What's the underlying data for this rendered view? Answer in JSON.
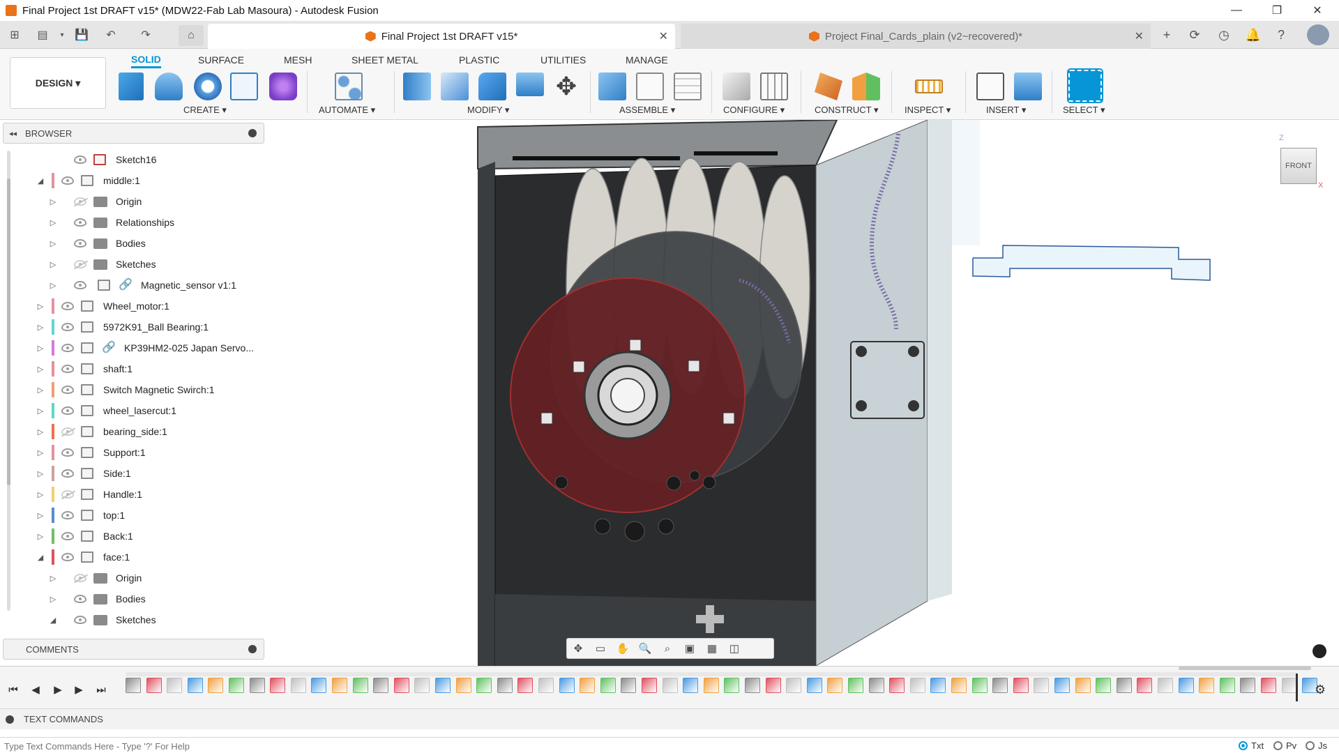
{
  "window": {
    "title": "Final Project 1st DRAFT v15* (MDW22-Fab Lab Masoura) - Autodesk Fusion",
    "controls": [
      "—",
      "❐",
      "✕"
    ]
  },
  "tabs": [
    {
      "label": "Final Project 1st DRAFT v15*",
      "active": true
    },
    {
      "label": "Project Final_Cards_plain (v2~recovered)*",
      "active": false
    }
  ],
  "tab_close": "✕",
  "workspace": {
    "label": "DESIGN ▾"
  },
  "ribbon_tabs": [
    "SOLID",
    "SURFACE",
    "MESH",
    "SHEET METAL",
    "PLASTIC",
    "UTILITIES",
    "MANAGE"
  ],
  "ribbon_groups": [
    "CREATE ▾",
    "AUTOMATE ▾",
    "MODIFY ▾",
    "ASSEMBLE ▾",
    "CONFIGURE ▾",
    "CONSTRUCT ▾",
    "INSPECT ▾",
    "INSERT ▾",
    "SELECT ▾"
  ],
  "browser": {
    "title": "BROWSER",
    "items": [
      {
        "label": "Sketch16",
        "level": 2,
        "toggle": "",
        "icon": "sketch",
        "color": "",
        "visible": true
      },
      {
        "label": "middle:1",
        "level": 1,
        "toggle": "◢",
        "icon": "component",
        "color": "#e8909e",
        "visible": true
      },
      {
        "label": "Origin",
        "level": 2,
        "toggle": "▷",
        "icon": "folder",
        "color": "",
        "visible": false
      },
      {
        "label": "Relationships",
        "level": 2,
        "toggle": "▷",
        "icon": "folder",
        "color": "",
        "visible": true
      },
      {
        "label": "Bodies",
        "level": 2,
        "toggle": "▷",
        "icon": "folder",
        "color": "",
        "visible": true
      },
      {
        "label": "Sketches",
        "level": 2,
        "toggle": "▷",
        "icon": "folder",
        "color": "",
        "visible": false
      },
      {
        "label": "Magnetic_sensor v1:1",
        "level": 2,
        "toggle": "▷",
        "icon": "linked",
        "color": "",
        "visible": true
      },
      {
        "label": "Wheel_motor:1",
        "level": 1,
        "toggle": "▷",
        "icon": "component",
        "color": "#e8909e",
        "visible": true
      },
      {
        "label": "5972K91_Ball Bearing:1",
        "level": 1,
        "toggle": "▷",
        "icon": "component",
        "color": "#5fd6d6",
        "visible": true
      },
      {
        "label": "KP39HM2-025 Japan Servo...",
        "level": 1,
        "toggle": "▷",
        "icon": "linked",
        "color": "#d67ad6",
        "visible": true
      },
      {
        "label": "shaft:1",
        "level": 1,
        "toggle": "▷",
        "icon": "component",
        "color": "#e8909e",
        "visible": true
      },
      {
        "label": "Switch Magnetic Swirch:1",
        "level": 1,
        "toggle": "▷",
        "icon": "component",
        "color": "#f0a070",
        "visible": true
      },
      {
        "label": "wheel_lasercut:1",
        "level": 1,
        "toggle": "▷",
        "icon": "component",
        "color": "#5fd6c6",
        "visible": true
      },
      {
        "label": "bearing_side:1",
        "level": 1,
        "toggle": "▷",
        "icon": "component",
        "color": "#f07050",
        "visible": false
      },
      {
        "label": "Support:1",
        "level": 1,
        "toggle": "▷",
        "icon": "component",
        "color": "#e8909e",
        "visible": true
      },
      {
        "label": "Side:1",
        "level": 1,
        "toggle": "▷",
        "icon": "component",
        "color": "#d0a0a0",
        "visible": true
      },
      {
        "label": "Handle:1",
        "level": 1,
        "toggle": "▷",
        "icon": "component",
        "color": "#f0d070",
        "visible": false
      },
      {
        "label": "top:1",
        "level": 1,
        "toggle": "▷",
        "icon": "component",
        "color": "#5a8ad6",
        "visible": true
      },
      {
        "label": "Back:1",
        "level": 1,
        "toggle": "▷",
        "icon": "component",
        "color": "#70c060",
        "visible": true
      },
      {
        "label": "face:1",
        "level": 1,
        "toggle": "◢",
        "icon": "component",
        "color": "#e05060",
        "visible": true
      },
      {
        "label": "Origin",
        "level": 2,
        "toggle": "▷",
        "icon": "folder",
        "color": "",
        "visible": false
      },
      {
        "label": "Bodies",
        "level": 2,
        "toggle": "▷",
        "icon": "folder",
        "color": "",
        "visible": true
      },
      {
        "label": "Sketches",
        "level": 2,
        "toggle": "◢",
        "icon": "folder",
        "color": "",
        "visible": true
      }
    ]
  },
  "comments": {
    "title": "COMMENTS"
  },
  "viewcube": {
    "face": "FRONT",
    "axis_z": "Z",
    "axis_x": "X"
  },
  "text_commands": {
    "title": "TEXT COMMANDS",
    "placeholder": "Type Text Commands Here - Type '?' For Help",
    "modes": [
      {
        "label": "Txt",
        "selected": true
      },
      {
        "label": "Pv",
        "selected": false
      },
      {
        "label": "Js",
        "selected": false
      }
    ]
  }
}
